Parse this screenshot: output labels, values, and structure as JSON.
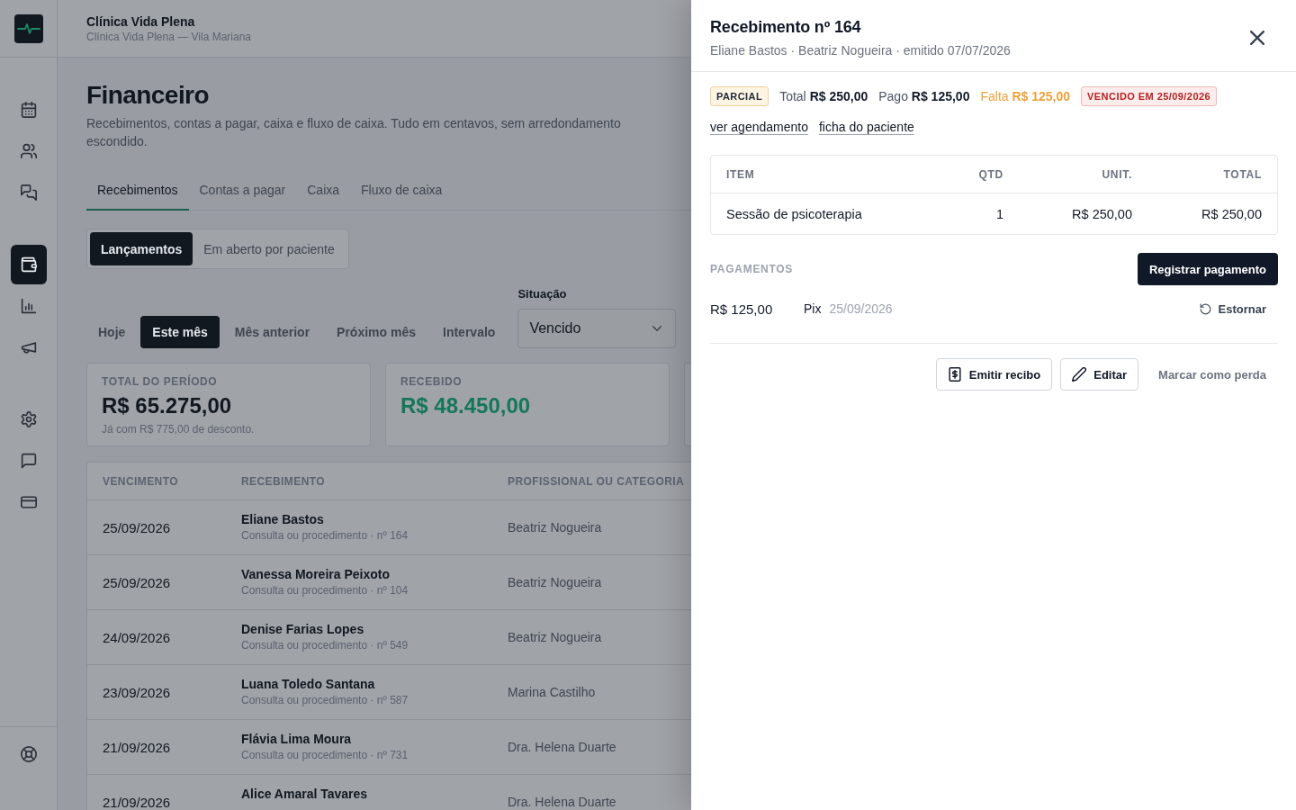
{
  "sidebar": {
    "sections": [
      {
        "items": [
          {
            "kind": "calendar",
            "selected": false
          },
          {
            "kind": "users",
            "selected": false
          },
          {
            "kind": "chats",
            "selected": false
          }
        ]
      },
      {
        "items": [
          {
            "kind": "wallet",
            "selected": true
          },
          {
            "kind": "chart",
            "selected": false
          },
          {
            "kind": "megaphone",
            "selected": false
          }
        ]
      },
      {
        "items": [
          {
            "kind": "settings",
            "selected": false
          },
          {
            "kind": "message",
            "selected": false
          },
          {
            "kind": "card",
            "selected": false
          }
        ]
      }
    ],
    "footer": [
      {
        "kind": "help",
        "selected": false
      }
    ]
  },
  "header": {
    "title": "Clínica Vida Plena",
    "subtitle": "Clínica Vida Plena — Vila Mariana"
  },
  "page": {
    "title": "Financeiro",
    "description": "Recebimentos, contas a pagar, caixa e fluxo de caixa. Tudo em centavos, sem arredondamento escondido."
  },
  "tabs": [
    {
      "label": "Recebimentos",
      "selected": true
    },
    {
      "label": "Contas a pagar",
      "selected": false
    },
    {
      "label": "Caixa",
      "selected": false
    },
    {
      "label": "Fluxo de caixa",
      "selected": false
    }
  ],
  "views": [
    {
      "label": "Lançamentos",
      "selected": true
    },
    {
      "label": "Em aberto por paciente",
      "selected": false
    }
  ],
  "periods": [
    {
      "label": "Hoje",
      "selected": false
    },
    {
      "label": "Este mês",
      "selected": true
    },
    {
      "label": "Mês anterior",
      "selected": false
    },
    {
      "label": "Próximo mês",
      "selected": false
    },
    {
      "label": "Intervalo",
      "selected": false
    }
  ],
  "status_filter": {
    "label": "Situação",
    "value": "Vencido"
  },
  "stats": [
    {
      "label": "TOTAL DO PERÍODO",
      "value": "R$ 65.275,00",
      "note": "Já com R$ 775,00 de desconto.",
      "kind": "neutral"
    },
    {
      "label": "RECEBIDO",
      "value": "R$ 48.450,00",
      "kind": "positive"
    }
  ],
  "table": {
    "columns": [
      "VENCIMENTO",
      "RECEBIMENTO",
      "PROFISSIONAL OU CATEGORIA"
    ],
    "rows": [
      {
        "due": "25/09/2026",
        "name": "Eliane Bastos",
        "detail": "Consulta ou procedimento · nº 164",
        "professional": "Beatriz Nogueira"
      },
      {
        "due": "25/09/2026",
        "name": "Vanessa Moreira Peixoto",
        "detail": "Consulta ou procedimento · nº 104",
        "professional": "Beatriz Nogueira"
      },
      {
        "due": "24/09/2026",
        "name": "Denise Farias Lopes",
        "detail": "Consulta ou procedimento · nº 549",
        "professional": "Beatriz Nogueira"
      },
      {
        "due": "23/09/2026",
        "name": "Luana Toledo Santana",
        "detail": "Consulta ou procedimento · nº 587",
        "professional": "Marina Castilho"
      },
      {
        "due": "21/09/2026",
        "name": "Flávia Lima Moura",
        "detail": "Consulta ou procedimento · nº 731",
        "professional": "Dra. Helena Duarte"
      },
      {
        "due": "21/09/2026",
        "name": "Alice Amaral Tavares",
        "professional": "Dra. Helena Duarte"
      }
    ]
  },
  "drawer": {
    "title": "Recebimento nº 164",
    "subtitle": "Eliane Bastos · Beatriz Nogueira · emitido 07/07/2026",
    "status": {
      "label": "PARCIAL",
      "kind": "partial"
    },
    "amounts": [
      {
        "text": "Total **R$ 250,00**",
        "kind": "neutral"
      },
      {
        "text": "Pago **R$ 125,00**",
        "kind": "neutral"
      },
      {
        "text": "Falta **R$ 125,00**",
        "kind": "warning"
      }
    ],
    "due_badge": {
      "label": "VENCIDO EM 25/09/2026",
      "kind": "overdue"
    },
    "links": [
      "ver agendamento",
      "ficha do paciente"
    ],
    "items_table": {
      "columns": [
        "ITEM",
        "QTD",
        "UNIT.",
        "TOTAL"
      ],
      "rows": [
        [
          "Sessão de psicoterapia",
          "1",
          "R$ 250,00",
          "R$ 250,00"
        ]
      ]
    },
    "payments": {
      "title": "PAGAMENTOS",
      "action": "Registrar pagamento",
      "rows": [
        {
          "amount": "R$ 125,00",
          "method": "Pix",
          "date": "25/09/2026",
          "action": "Estornar"
        }
      ]
    },
    "actions": [
      {
        "label": "Emitir recibo",
        "kind": "receipt"
      },
      {
        "label": "Editar",
        "kind": "edit"
      },
      {
        "label": "Marcar como perda",
        "kind": "text"
      }
    ]
  }
}
